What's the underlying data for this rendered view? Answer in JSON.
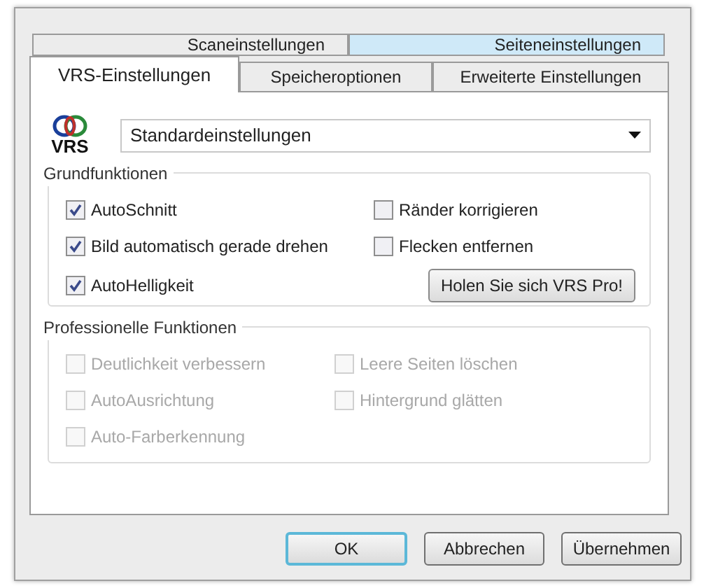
{
  "tab_rows": [
    {
      "tabs": [
        {
          "label": "Scaneinstellungen",
          "selected": false
        },
        {
          "label": "Seiteneinstellungen",
          "selected": true
        }
      ]
    },
    {
      "tabs": [
        {
          "label": "VRS-Einstellungen",
          "selected": true
        },
        {
          "label": "Speicheroptionen",
          "selected": false
        },
        {
          "label": "Erweiterte Einstellungen",
          "selected": false
        }
      ]
    }
  ],
  "logo": {
    "text": "VRS"
  },
  "profile_dropdown": {
    "value": "Standardeinstellungen"
  },
  "groups": [
    {
      "title": "Grundfunktionen",
      "items": [
        {
          "kind": "checkbox",
          "label": "AutoSchnitt",
          "checked": true,
          "disabled": false
        },
        {
          "kind": "checkbox",
          "label": "Ränder korrigieren",
          "checked": false,
          "disabled": false
        },
        {
          "kind": "checkbox",
          "label": "Bild automatisch gerade drehen",
          "checked": true,
          "disabled": false
        },
        {
          "kind": "checkbox",
          "label": "Flecken entfernen",
          "checked": false,
          "disabled": false
        },
        {
          "kind": "checkbox",
          "label": "AutoHelligkeit",
          "checked": true,
          "disabled": false
        },
        {
          "kind": "button",
          "label": "Holen Sie sich VRS Pro!"
        }
      ]
    },
    {
      "title": "Professionelle Funktionen",
      "items": [
        {
          "kind": "checkbox",
          "label": "Deutlichkeit verbessern",
          "checked": false,
          "disabled": true
        },
        {
          "kind": "checkbox",
          "label": "Leere Seiten löschen",
          "checked": false,
          "disabled": true
        },
        {
          "kind": "checkbox",
          "label": "AutoAusrichtung",
          "checked": false,
          "disabled": true
        },
        {
          "kind": "checkbox",
          "label": "Hintergrund glätten",
          "checked": false,
          "disabled": true
        },
        {
          "kind": "checkbox",
          "label": "Auto-Farberkennung",
          "checked": false,
          "disabled": true
        }
      ]
    }
  ],
  "buttons": [
    {
      "label": "OK",
      "default": true
    },
    {
      "label": "Abbrechen",
      "default": false
    },
    {
      "label": "Übernehmen",
      "default": false
    }
  ]
}
